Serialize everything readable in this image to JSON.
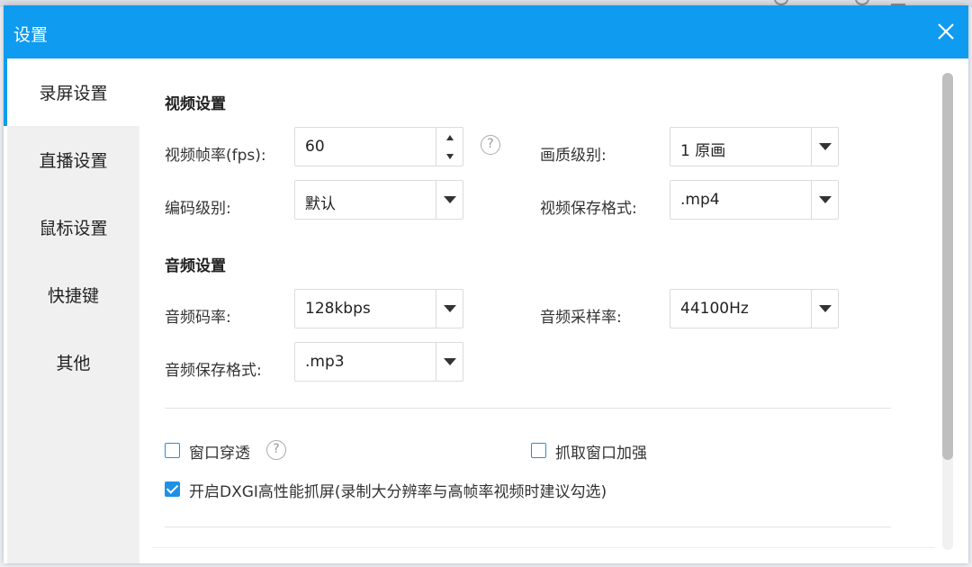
{
  "window": {
    "title": "设置"
  },
  "sidebar": {
    "items": [
      {
        "label": "录屏设置",
        "active": true
      },
      {
        "label": "直播设置",
        "active": false
      },
      {
        "label": "鼠标设置",
        "active": false
      },
      {
        "label": "快捷键",
        "active": false
      },
      {
        "label": "其他",
        "active": false
      }
    ]
  },
  "video": {
    "section_title": "视频设置",
    "fps_label": "视频帧率(fps):",
    "fps_value": "60",
    "quality_label": "画质级别:",
    "quality_value": "1 原画",
    "encode_label": "编码级别:",
    "encode_value": "默认",
    "format_label": "视频保存格式:",
    "format_value": ".mp4"
  },
  "audio": {
    "section_title": "音频设置",
    "bitrate_label": "音频码率:",
    "bitrate_value": "128kbps",
    "samplerate_label": "音频采样率:",
    "samplerate_value": "44100Hz",
    "format_label": "音频保存格式:",
    "format_value": ".mp3"
  },
  "options": {
    "window_through": {
      "label": "窗口穿透",
      "checked": false
    },
    "capture_enhance": {
      "label": "抓取窗口加强",
      "checked": false
    },
    "dxgi": {
      "label": "开启DXGI高性能抓屏(录制大分辨率与高帧率视频时建议勾选)",
      "checked": true
    }
  },
  "icons": {
    "close": "close-icon",
    "help": "question-icon",
    "dropdown": "chevron-down-icon"
  },
  "colors": {
    "accent": "#0f9bf0",
    "checkbox": "#1e90e6"
  }
}
